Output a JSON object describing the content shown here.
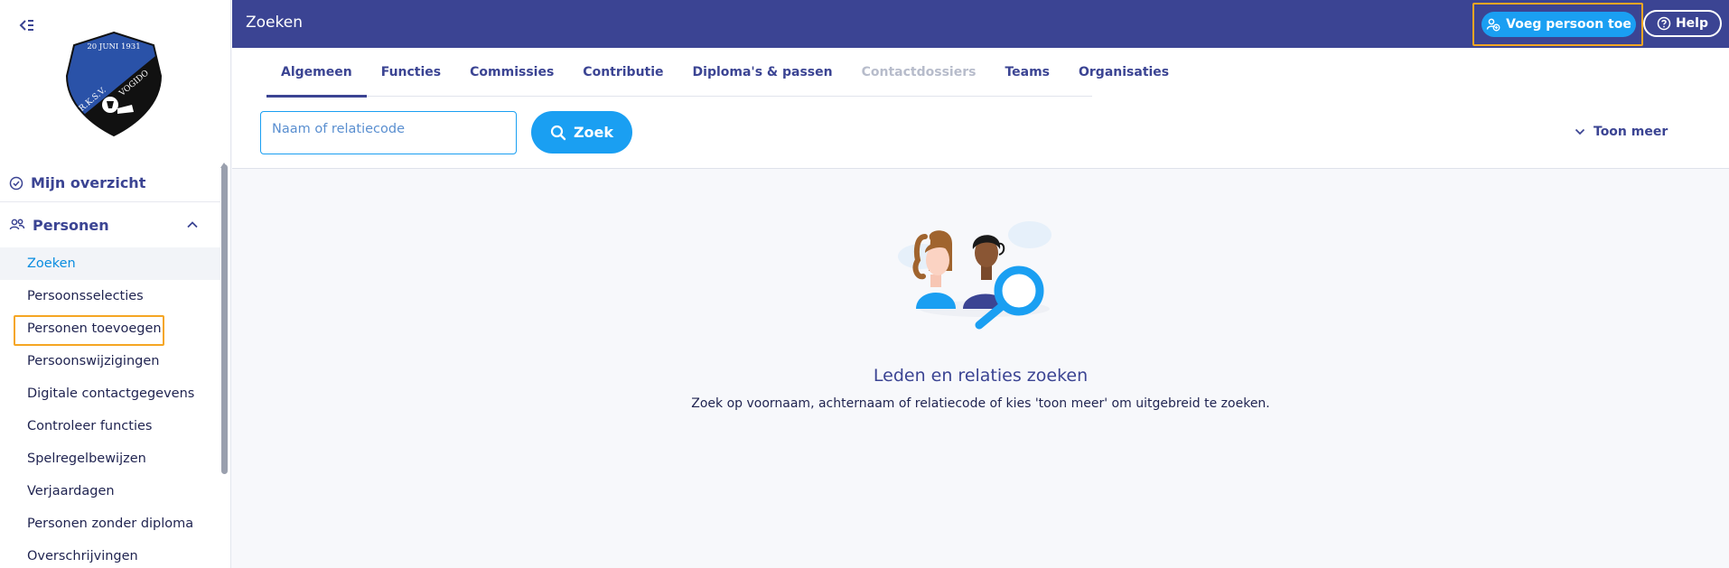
{
  "header": {
    "title": "Zoeken",
    "add_person_label": "Voeg persoon toe",
    "help_label": "Help"
  },
  "logo": {
    "date_text": "20 JUNI 1931",
    "club_left": "R.K.S.V.",
    "club_right": "VOGIDO"
  },
  "sidebar": {
    "overview_label": "Mijn overzicht",
    "group_label": "Personen",
    "items": [
      {
        "label": "Zoeken",
        "active": true
      },
      {
        "label": "Persoonsselecties"
      },
      {
        "label": "Personen toevoegen",
        "highlight": true
      },
      {
        "label": "Persoonswijzigingen"
      },
      {
        "label": "Digitale contactgegevens"
      },
      {
        "label": "Controleer functies"
      },
      {
        "label": "Spelregelbewijzen"
      },
      {
        "label": "Verjaardagen"
      },
      {
        "label": "Personen zonder diploma"
      },
      {
        "label": "Overschrijvingen"
      }
    ]
  },
  "tabs": [
    {
      "label": "Algemeen",
      "active": true
    },
    {
      "label": "Functies"
    },
    {
      "label": "Commissies"
    },
    {
      "label": "Contributie"
    },
    {
      "label": "Diploma's & passen"
    },
    {
      "label": "Contactdossiers",
      "disabled": true
    },
    {
      "label": "Teams"
    },
    {
      "label": "Organisaties"
    }
  ],
  "search": {
    "placeholder": "Naam of relatiecode",
    "value": "",
    "button_label": "Zoek",
    "more_label": "Toon meer"
  },
  "empty_state": {
    "title": "Leden en relaties zoeken",
    "text": "Zoek op voornaam, achternaam of relatiecode of kies 'toon meer' om uitgebreid te zoeken."
  },
  "colors": {
    "primary": "#3b4493",
    "accent": "#1a9ff2",
    "highlight": "#f5a623"
  }
}
